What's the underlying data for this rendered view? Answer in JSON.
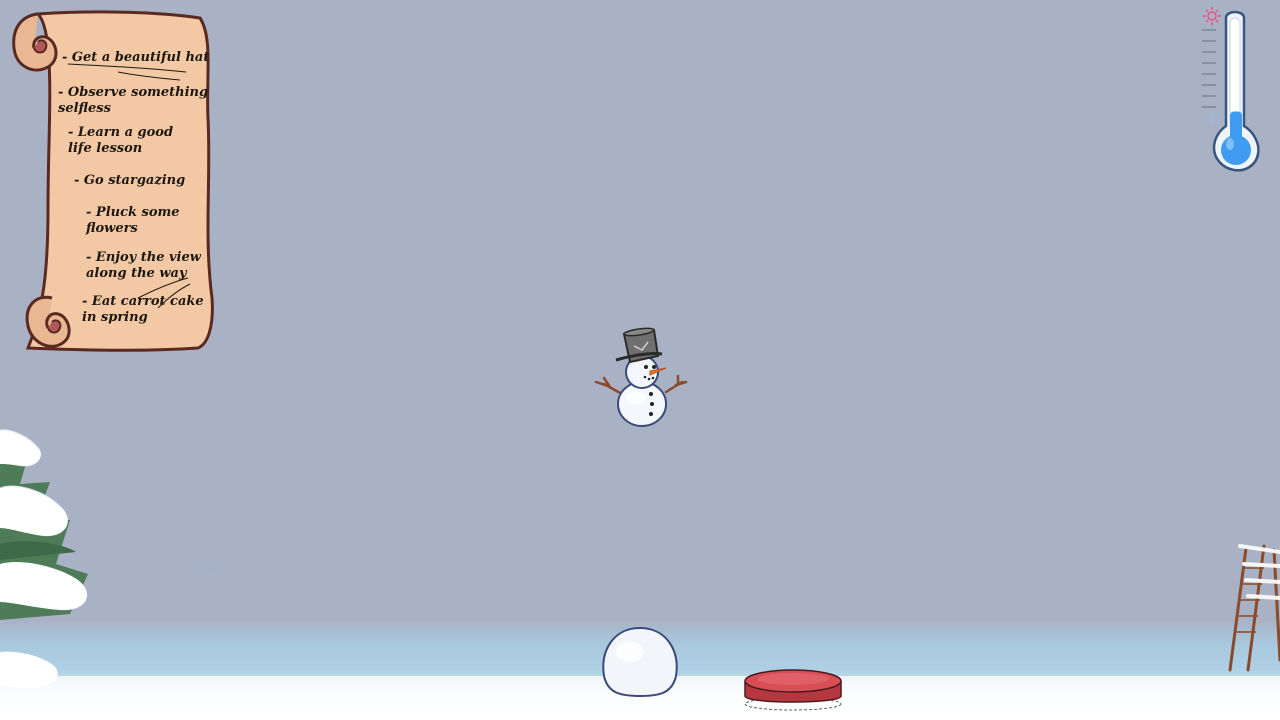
{
  "game": {
    "name": "snowman-scene"
  },
  "scroll": {
    "tasks": [
      {
        "label": "- Get a beautiful hat",
        "completed": true
      },
      {
        "label": "- Observe something\nselfless",
        "completed": false
      },
      {
        "label": "- Learn a good\nlife lesson",
        "completed": false
      },
      {
        "label": "- Go stargazing",
        "completed": false
      },
      {
        "label": "- Pluck some\nflowers",
        "completed": false
      },
      {
        "label": "- Enjoy the view\nalong the way",
        "completed": false
      },
      {
        "label": "- Eat carrot cake\nin spring",
        "completed": true
      }
    ]
  },
  "thermometer": {
    "level": 0.25,
    "hot_icon": "sun-icon",
    "cold_icon": "snowflake-icon"
  },
  "colors": {
    "sky": "#a9b2c4",
    "scroll_paper": "#f2c9a4",
    "scroll_border": "#5a2a22",
    "mercury": "#3f9cf0",
    "button_red": "#d94d55",
    "tree_green": "#4e7c58",
    "hat_gray": "#6f6f6f",
    "carrot": "#f07a2a",
    "sun_pink": "#e8508a"
  }
}
